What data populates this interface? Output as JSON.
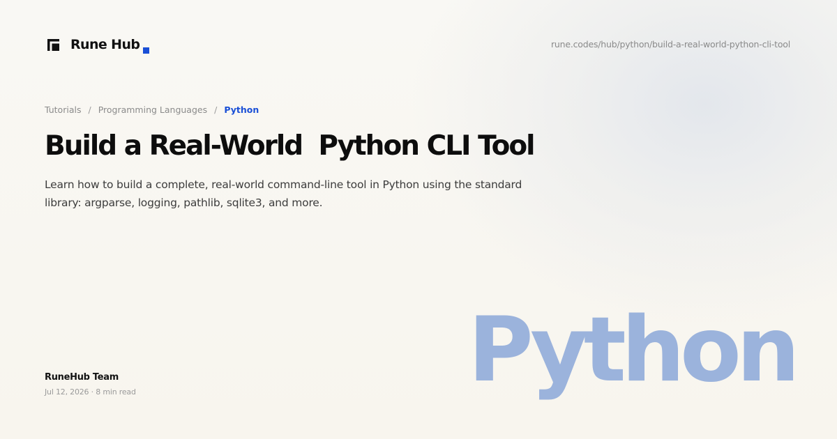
{
  "brand": {
    "name": "Rune Hub",
    "accent_color": "#1a4fd6"
  },
  "url": "rune.codes/hub/python/build-a-real-world-python-cli-tool",
  "breadcrumb": {
    "items": [
      "Tutorials",
      "Programming Languages"
    ],
    "current": "Python",
    "separator": "/"
  },
  "article": {
    "title": "Build a Real-World  Python CLI Tool",
    "description": "Learn how to build a complete, real-world command-line tool in Python using the standard library: argparse, logging, pathlib, sqlite3, and more.",
    "author": "RuneHub Team",
    "meta": "Jul 12, 2026 · 8 min read"
  },
  "hero_word": {
    "text": "Python",
    "color": "#9bb3dc"
  },
  "icons": {
    "logo": "rune-hub-logo-icon"
  }
}
